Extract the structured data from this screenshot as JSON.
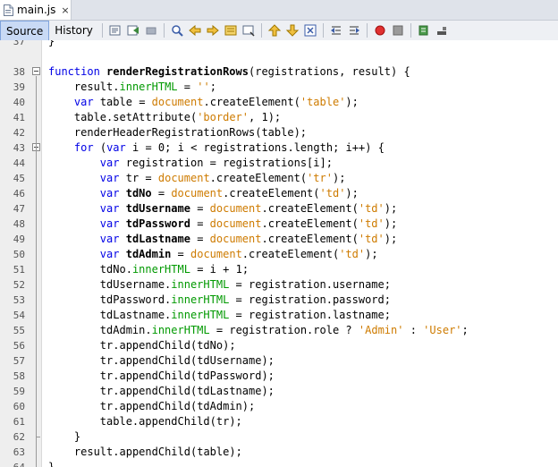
{
  "file_tab": {
    "label": "main.js",
    "close": "×"
  },
  "view_tabs": [
    {
      "label": "Source",
      "active": true
    },
    {
      "label": "History",
      "active": false
    }
  ],
  "toolbar_icons": [
    "last-edit-icon",
    "back-icon",
    "forward-icon",
    "find-icon",
    "find-previous-icon",
    "find-next-icon",
    "toggle-highlight-icon",
    "toggle-bookmark-icon",
    "previous-bookmark-icon",
    "next-bookmark-icon",
    "toggle-comment-icon",
    "shift-left-icon",
    "shift-right-icon",
    "start-macro-icon",
    "stop-macro-icon",
    "run-icon",
    "history-icon"
  ],
  "lines": [
    {
      "n": "37",
      "t": "}"
    },
    {
      "n": "38",
      "t": ""
    },
    {
      "n": "38",
      "t": "function renderRegistrationRows(registrations, result) {"
    },
    {
      "n": "39",
      "t": "    result.innerHTML = '';"
    },
    {
      "n": "40",
      "t": "    var table = document.createElement('table');"
    },
    {
      "n": "41",
      "t": "    table.setAttribute('border', 1);"
    },
    {
      "n": "42",
      "t": "    renderHeaderRegistrationRows(table);"
    },
    {
      "n": "43",
      "t": "    for (var i = 0; i < registrations.length; i++) {"
    },
    {
      "n": "44",
      "t": "        var registration = registrations[i];"
    },
    {
      "n": "45",
      "t": "        var tr = document.createElement('tr');"
    },
    {
      "n": "46",
      "t": "        var tdNo = document.createElement('td');"
    },
    {
      "n": "47",
      "t": "        var tdUsername = document.createElement('td');"
    },
    {
      "n": "48",
      "t": "        var tdPassword = document.createElement('td');"
    },
    {
      "n": "49",
      "t": "        var tdLastname = document.createElement('td');"
    },
    {
      "n": "50",
      "t": "        var tdAdmin = document.createElement('td');"
    },
    {
      "n": "51",
      "t": "        tdNo.innerHTML = i + 1;"
    },
    {
      "n": "52",
      "t": "        tdUsername.innerHTML = registration.username;"
    },
    {
      "n": "53",
      "t": "        tdPassword.innerHTML = registration.password;"
    },
    {
      "n": "54",
      "t": "        tdLastname.innerHTML = registration.lastname;"
    },
    {
      "n": "55",
      "t": "        tdAdmin.innerHTML = registration.role ? 'Admin' : 'User';"
    },
    {
      "n": "56",
      "t": "        tr.appendChild(tdNo);"
    },
    {
      "n": "57",
      "t": "        tr.appendChild(tdUsername);"
    },
    {
      "n": "58",
      "t": "        tr.appendChild(tdPassword);"
    },
    {
      "n": "59",
      "t": "        tr.appendChild(tdLastname);"
    },
    {
      "n": "60",
      "t": "        tr.appendChild(tdAdmin);"
    },
    {
      "n": "61",
      "t": "        table.appendChild(tr);"
    },
    {
      "n": "62",
      "t": "    }"
    },
    {
      "n": "63",
      "t": "    result.appendChild(table);"
    },
    {
      "n": "64",
      "t": "}"
    }
  ]
}
